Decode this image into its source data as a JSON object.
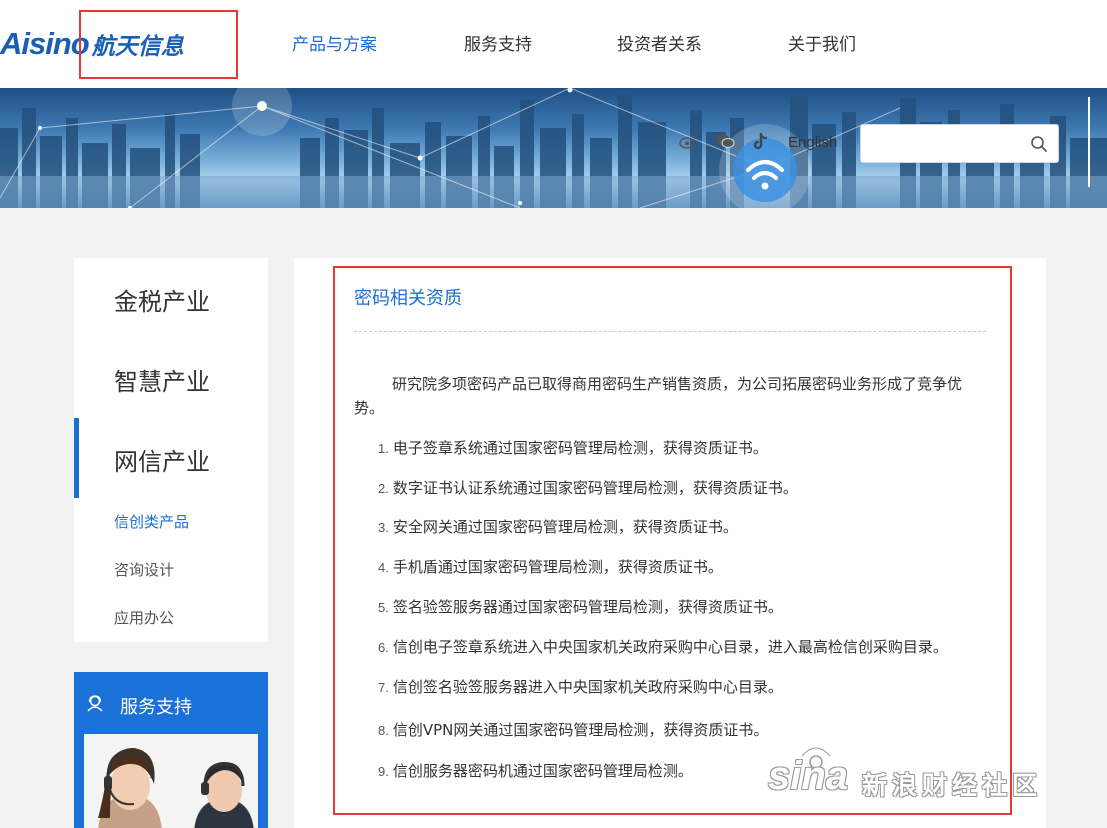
{
  "brand": {
    "logo_latin": "Aisino",
    "logo_cn": "航天信息"
  },
  "nav": {
    "items": [
      {
        "label": "产品与方案",
        "active": true
      },
      {
        "label": "服务支持",
        "active": false
      },
      {
        "label": "投资者关系",
        "active": false
      },
      {
        "label": "关于我们",
        "active": false
      }
    ]
  },
  "banner": {
    "social_icons": [
      "weibo-icon",
      "wechat-icon",
      "tiktok-icon"
    ],
    "language_link": "English",
    "search": {
      "placeholder": "",
      "value": ""
    }
  },
  "sidebar": {
    "categories": [
      {
        "label": "金税产业",
        "active": false
      },
      {
        "label": "智慧产业",
        "active": false
      },
      {
        "label": "网信产业",
        "active": true
      }
    ],
    "subitems": [
      {
        "label": "信创类产品",
        "active": true
      },
      {
        "label": "咨询设计",
        "active": false
      },
      {
        "label": "应用办公",
        "active": false
      }
    ],
    "service": {
      "title": "服务支持",
      "icon": "headset-icon"
    }
  },
  "content": {
    "title": "密码相关资质",
    "intro": "研究院多项密码产品已取得商用密码生产销售资质，为公司拓展密码业务形成了竞争优势。",
    "items": [
      {
        "num": "1.",
        "text": "电子签章系统通过国家密码管理局检测，获得资质证书。"
      },
      {
        "num": "2.",
        "text": "数字证书认证系统通过国家密码管理局检测，获得资质证书。"
      },
      {
        "num": "3.",
        "text": "安全网关通过国家密码管理局检测，获得资质证书。"
      },
      {
        "num": "4.",
        "text": "手机盾通过国家密码管理局检测，获得资质证书。"
      },
      {
        "num": "5.",
        "text": "签名验签服务器通过国家密码管理局检测，获得资质证书。"
      },
      {
        "num": "6.",
        "text": "信创电子签章系统进入中央国家机关政府采购中心目录，进入最高检信创采购目录。"
      },
      {
        "num": "7.",
        "text": "信创签名验签服务器进入中央国家机关政府采购中心目录。"
      },
      {
        "num": "8.",
        "text": "信创VPN网关通过国家密码管理局检测，获得资质证书。"
      },
      {
        "num": "9.",
        "text": "信创服务器密码机通过国家密码管理局检测。"
      }
    ]
  },
  "watermark": {
    "latin": "sina",
    "cn": "新浪财经社区"
  },
  "colors": {
    "accent": "#1a6fd0",
    "highlight": "#e53935",
    "service_bg": "#1a72d8"
  }
}
